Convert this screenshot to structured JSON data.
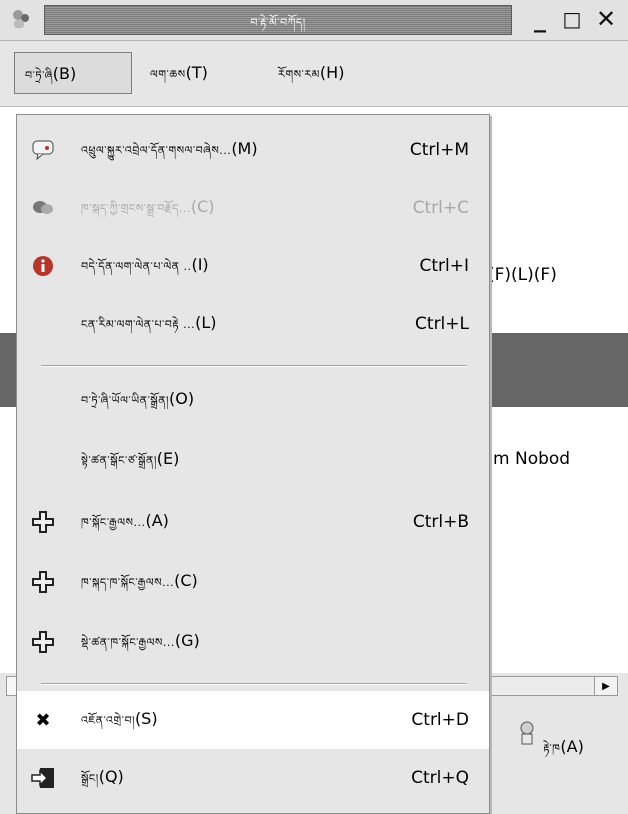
{
  "window": {
    "title": "བ་རྟེ་མོ་བཀོད།",
    "minimize_glyph": "_",
    "maximize_glyph": "□",
    "close_glyph": "✕"
  },
  "menubar": {
    "items": [
      {
        "label": "བ་ཏྲེ་ཞི",
        "accel": "(B)",
        "state": "open"
      },
      {
        "label": "ལག་ཆས",
        "accel": "(T)"
      },
      {
        "label": "རོགས་རམ",
        "accel": "(H)"
      }
    ]
  },
  "background": {
    "text_row1": "(F)(L)(F)",
    "text_row2": "Im Nobod"
  },
  "dropdown": {
    "items": [
      {
        "icon": "chat-icon",
        "label": "འཕྲུལ་སྐྱུར་འབྲེལ་དོན་གསལ་བཞེས...",
        "accel": "(M)",
        "shortcut": "Ctrl+M",
        "disabled": false
      },
      {
        "icon": "chat-bubbles-icon",
        "label": "ཁ་སྐད་ཀྱི་གྲངས་སྒྲ་བརྗོད...",
        "accel": "(C)",
        "shortcut": "Ctrl+C",
        "disabled": true
      },
      {
        "icon": "info-icon",
        "label": "བདེ་དོན་ལག་ལེན་པ་ལེན ..",
        "accel": "(I)",
        "shortcut": "Ctrl+I",
        "disabled": false
      },
      {
        "icon": "none",
        "label": "ངན་རིམ་ལག་ལེན་པ་བརྟེ ...",
        "accel": "(L)",
        "shortcut": "Ctrl+L",
        "disabled": false
      },
      {
        "icon": "none",
        "label": "བ་ཏྲེ་ཞི་ཡོལ་ཡིན་སྒྲོན།",
        "accel": "(O)",
        "shortcut": "",
        "disabled": false
      },
      {
        "icon": "none",
        "label": "སྟེ་ཚན་སྒོང་ཙ་སྒྲོན།",
        "accel": "(E)",
        "shortcut": "",
        "disabled": false
      },
      {
        "icon": "add-buddy-icon",
        "label": "ཁ་སྐོང་རྒྱལས...",
        "accel": "(A)",
        "shortcut": "Ctrl+B",
        "disabled": false
      },
      {
        "icon": "add-chat-icon",
        "label": "ཁ་སྐད་ཁ་སྐོང་རྒྱལས...",
        "accel": "(C)",
        "shortcut": "",
        "disabled": false
      },
      {
        "icon": "add-group-icon",
        "label": "སྡེ་ཚན་ཁ་སྐོང་རྒྱལས...",
        "accel": "(G)",
        "shortcut": "",
        "disabled": false
      },
      {
        "icon": "close-x-icon",
        "label": "འཇོན་འགྲེ་བ།",
        "accel": "(S)",
        "shortcut": "Ctrl+D",
        "disabled": false,
        "highlighted": true
      },
      {
        "icon": "quit-icon",
        "label": "སྒྲོང།",
        "accel": "(Q)",
        "shortcut": "Ctrl+Q",
        "disabled": false
      }
    ]
  },
  "toolbar": {
    "button_label": "རྟེ་ཁ",
    "button_accel": "(A)"
  },
  "colors": {
    "accent_red": "#c0342c",
    "info_red": "#b8352a",
    "selected_row": "#666666"
  }
}
